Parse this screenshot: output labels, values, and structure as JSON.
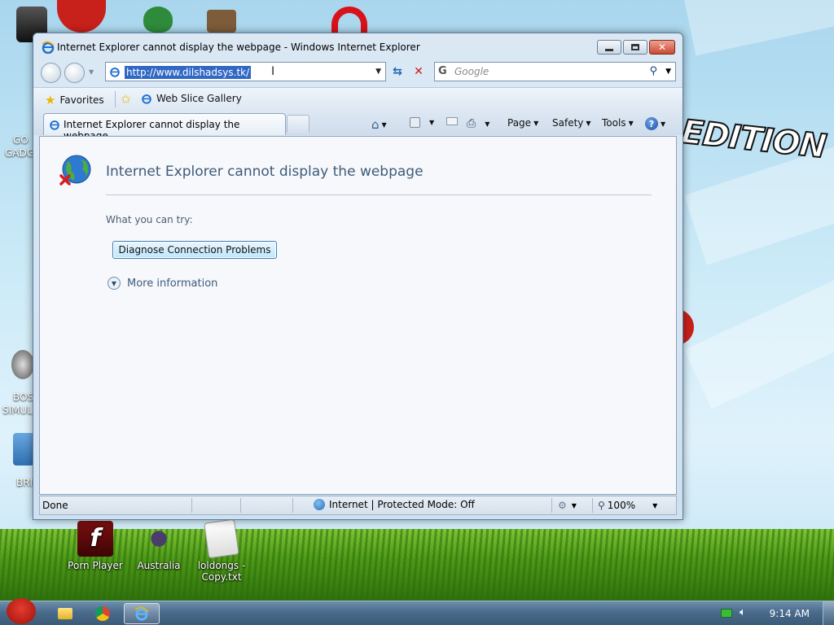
{
  "window": {
    "title": "Internet Explorer cannot display the webpage - Windows Internet Explorer"
  },
  "address_bar": {
    "url": "http://www.dilshadsys.tk/"
  },
  "search": {
    "placeholder": "Google"
  },
  "favorites_bar": {
    "favorites_label": "Favorites",
    "web_slice_label": "Web Slice Gallery"
  },
  "tab": {
    "label": "Internet Explorer cannot display the webpage"
  },
  "command_bar": {
    "page_label": "Page",
    "safety_label": "Safety",
    "tools_label": "Tools"
  },
  "content": {
    "heading": "Internet Explorer cannot display the webpage",
    "what_you_can_try": "What you can try:",
    "diagnose_button": "Diagnose Connection Problems",
    "more_info": "More information"
  },
  "status_bar": {
    "status": "Done",
    "zone": "Internet | Protected Mode: Off",
    "zoom": "100%"
  },
  "desktop": {
    "icons": [
      {
        "label": "Porn Player"
      },
      {
        "label": "Australia"
      },
      {
        "label": "loldongs - Copy.txt"
      }
    ],
    "partial_left_labels": [
      "GO",
      "GADG",
      "BOS",
      "SIMUL",
      "BRI"
    ],
    "wallpaper_text": "EDITION"
  },
  "taskbar": {
    "clock": "9:14 AM"
  },
  "colors": {
    "accent_selection": "#3168c5",
    "error_heading": "#3e5a7a",
    "close_button": "#c84a32"
  }
}
